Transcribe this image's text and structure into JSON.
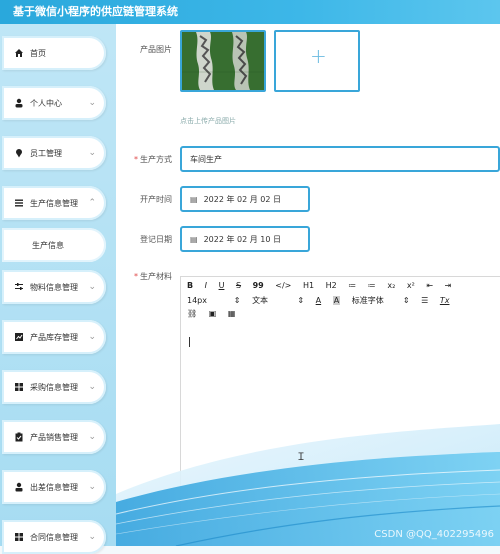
{
  "header": {
    "title": "基于微信小程序的供应链管理系统"
  },
  "sidebar": {
    "items": [
      {
        "label": "首页",
        "icon": "home-icon",
        "expandable": false
      },
      {
        "label": "个人中心",
        "icon": "user-icon",
        "expandable": true
      },
      {
        "label": "员工管理",
        "icon": "pin-icon",
        "expandable": true
      },
      {
        "label": "生产信息管理",
        "icon": "list-icon",
        "expandable": true
      },
      {
        "label": "物料信息管理",
        "icon": "sliders-icon",
        "expandable": true
      },
      {
        "label": "产品库存管理",
        "icon": "chart-icon",
        "expandable": true
      },
      {
        "label": "采购信息管理",
        "icon": "grid-icon",
        "expandable": true
      },
      {
        "label": "产品销售管理",
        "icon": "clipboard-icon",
        "expandable": true
      },
      {
        "label": "出差信息管理",
        "icon": "person-icon",
        "expandable": true
      },
      {
        "label": "合同信息管理",
        "icon": "grid-icon",
        "expandable": true
      }
    ],
    "sub_item": "生产信息"
  },
  "form": {
    "image_label": "产品图片",
    "upload_hint": "点击上传产品图片",
    "method_label": "生产方式",
    "method_value": "车间生产",
    "start_label": "开产时间",
    "start_value": "2022 年 02 月 02 日",
    "reg_label": "登记日期",
    "reg_value": "2022 年 02 月 10 日",
    "material_label": "生产材料",
    "plus_symbol": "+"
  },
  "editor": {
    "row1": [
      "B",
      "I",
      "U",
      "S",
      "99",
      "</>",
      "H1",
      "H2",
      "≔",
      "≔",
      "x₂",
      "x²",
      "⇤",
      "⇥"
    ],
    "font_size": "14px",
    "text_type": "文本",
    "font_family": "标准字体",
    "clear_format": "Tx"
  },
  "watermark": "CSDN @QQ_402295496",
  "colors": {
    "accent": "#39a6d9",
    "header": "#2aa8dc",
    "sidebar": "#a6dcf2"
  }
}
